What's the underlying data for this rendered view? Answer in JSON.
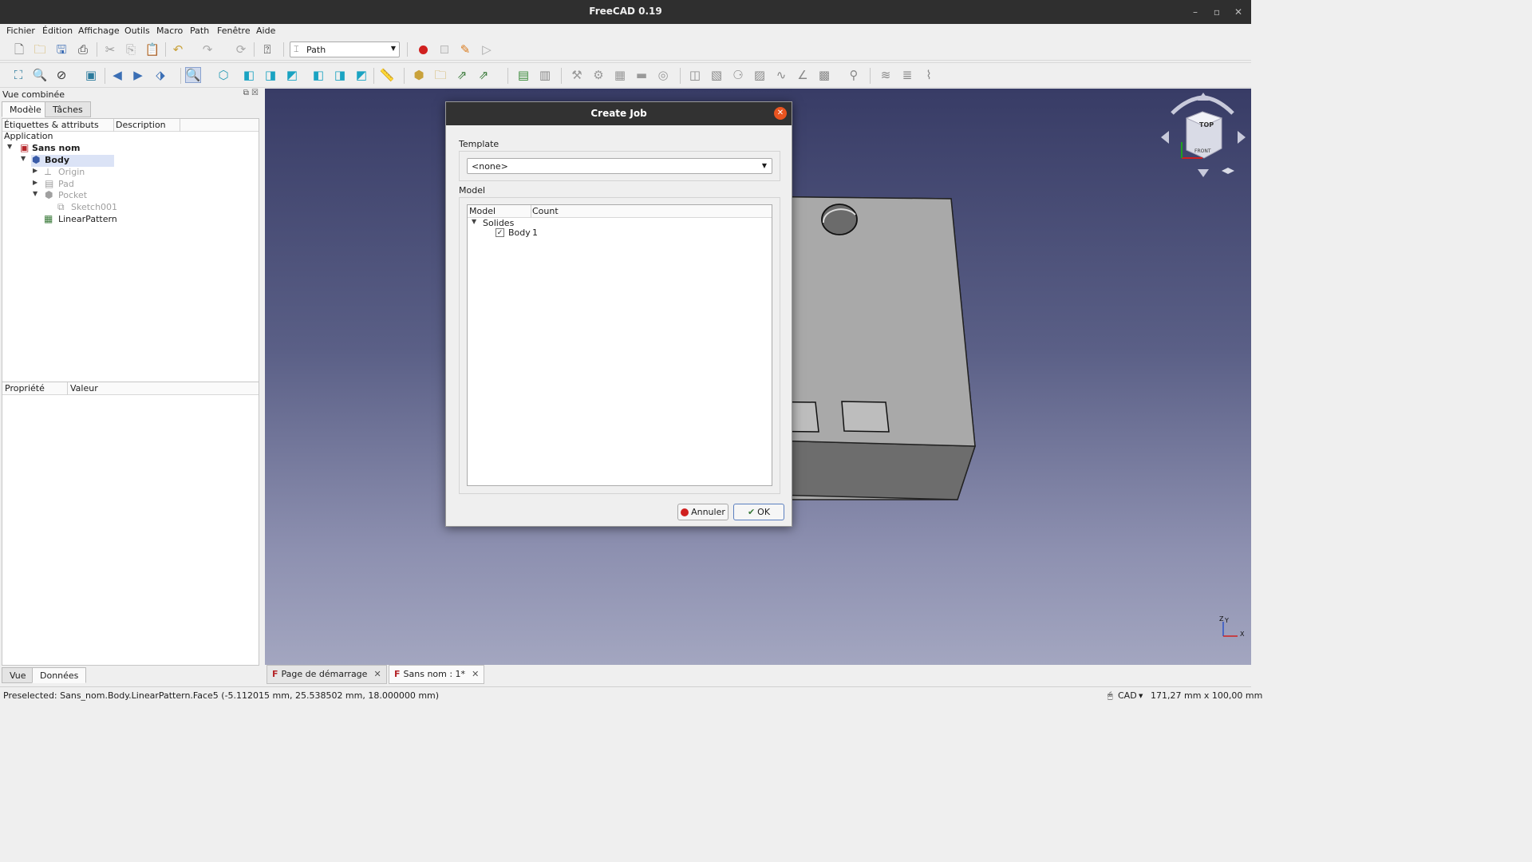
{
  "window": {
    "title": "FreeCAD 0.19"
  },
  "menu": [
    "Fichier",
    "Édition",
    "Affichage",
    "Outils",
    "Macro",
    "Path",
    "Fenêtre",
    "Aide"
  ],
  "toolbar": {
    "workbench": "Path"
  },
  "combo_view": {
    "title": "Vue combinée",
    "tabs": [
      "Modèle",
      "Tâches"
    ],
    "tree_headers": [
      "Étiquettes & attributs",
      "Description"
    ],
    "tree": {
      "application": "Application",
      "document": "Sans nom",
      "body": "Body",
      "origin": "Origin",
      "pad": "Pad",
      "pocket": "Pocket",
      "sketch": "Sketch001",
      "pattern": "LinearPattern"
    },
    "prop_headers": [
      "Propriété",
      "Valeur"
    ],
    "bottom_tabs": [
      "Vue",
      "Données"
    ]
  },
  "navcube": {
    "top_label": "TOP",
    "front_label": "FRONT"
  },
  "axes": {
    "x": "X",
    "y": "Y",
    "z": "Z"
  },
  "dialog": {
    "title": "Create Job",
    "template_label": "Template",
    "template_value": "<none>",
    "model_label": "Model",
    "model_headers": [
      "Model",
      "Count"
    ],
    "group": "Solides",
    "item_name": "Body",
    "item_count": "1",
    "cancel": "Annuler",
    "ok": "OK"
  },
  "doc_tabs": [
    "Page de démarrage",
    "Sans nom : 1*"
  ],
  "status": {
    "preselected": "Preselected: Sans_nom.Body.LinearPattern.Face5 (-5.112015 mm, 25.538502 mm, 18.000000 mm)",
    "nav_style": "CAD",
    "dimensions": "171,27 mm x 100,00 mm"
  },
  "colors": {
    "accent_close": "#e95420",
    "record": "#d0201f",
    "fc_tab_icon": "#b5262a",
    "selection": "#dbe3f6"
  }
}
